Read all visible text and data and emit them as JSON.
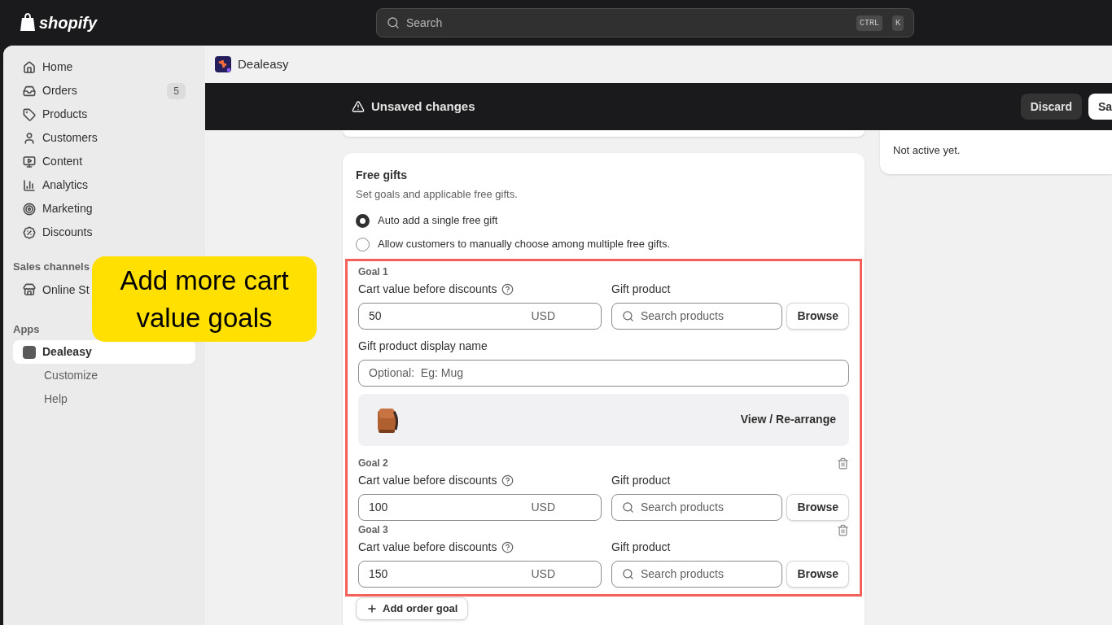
{
  "topbar": {
    "logo": "shopify",
    "search_placeholder": "Search",
    "shortcut": [
      "CTRL",
      "K"
    ]
  },
  "sidebar": {
    "items": [
      {
        "label": "Home",
        "selected": false
      },
      {
        "label": "Orders",
        "badge": "5",
        "selected": false
      },
      {
        "label": "Products",
        "selected": false
      },
      {
        "label": "Customers",
        "selected": false
      },
      {
        "label": "Content",
        "selected": false
      },
      {
        "label": "Analytics",
        "selected": false
      },
      {
        "label": "Marketing",
        "selected": false
      },
      {
        "label": "Discounts",
        "selected": false
      }
    ],
    "sales_channels": {
      "heading": "Sales channels",
      "items": [
        {
          "label": "Online St",
          "selected": false
        }
      ]
    },
    "apps": {
      "heading": "Apps",
      "items": [
        {
          "label": "Dealeasy",
          "selected": true,
          "children": [
            {
              "label": "Customize"
            },
            {
              "label": "Help"
            }
          ]
        }
      ]
    }
  },
  "app_header": {
    "title": "Dealeasy"
  },
  "save_bar": {
    "message": "Unsaved changes",
    "discard": "Discard",
    "save": "Sa"
  },
  "side_card": {
    "text": "Not active yet."
  },
  "free_gifts": {
    "title": "Free gifts",
    "subtitle": "Set goals and applicable free gifts.",
    "options": [
      {
        "label": "Auto add a single free gift",
        "selected": true
      },
      {
        "label": "Allow customers to manually choose among multiple free gifts.",
        "selected": false
      }
    ],
    "goals": [
      {
        "title": "Goal 1",
        "deletable": false,
        "cart_label": "Cart value before discounts",
        "value": "50",
        "currency": "USD",
        "gift_label": "Gift product",
        "gift_placeholder": "Search products",
        "browse": "Browse",
        "display_name_label": "Gift product display name",
        "display_name_placeholder": "Optional:  Eg: Mug",
        "preview_action": "View / Re-arrange"
      },
      {
        "title": "Goal 2",
        "deletable": true,
        "cart_label": "Cart value before discounts",
        "value": "100",
        "currency": "USD",
        "gift_label": "Gift product",
        "gift_placeholder": "Search products",
        "browse": "Browse"
      },
      {
        "title": "Goal 3",
        "deletable": true,
        "cart_label": "Cart value before discounts",
        "value": "150",
        "currency": "USD",
        "gift_label": "Gift product",
        "gift_placeholder": "Search products",
        "browse": "Browse"
      }
    ],
    "add_goal": "Add order goal"
  },
  "callout": {
    "text": "Add more cart value goals"
  }
}
